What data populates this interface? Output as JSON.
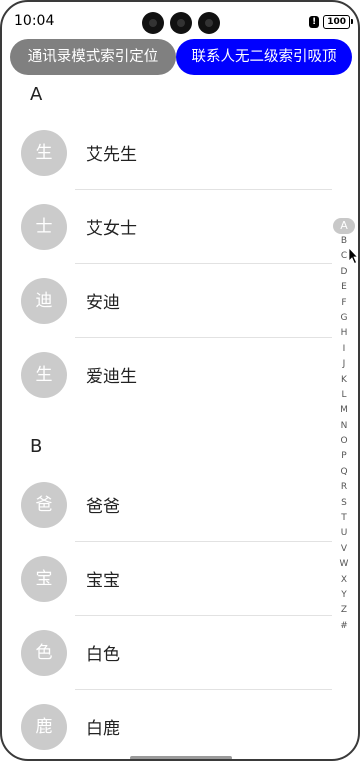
{
  "status_bar": {
    "time": "10:04",
    "alert": "!",
    "battery": "100"
  },
  "buttons": {
    "index_locate_label": "通讯录模式索引定位",
    "no_secondary_label": "联系人无二级索引吸顶"
  },
  "sections": [
    {
      "letter": "A",
      "contacts": [
        {
          "avatar": "生",
          "name": "艾先生"
        },
        {
          "avatar": "士",
          "name": "艾女士"
        },
        {
          "avatar": "迪",
          "name": "安迪"
        },
        {
          "avatar": "生",
          "name": "爱迪生"
        }
      ]
    },
    {
      "letter": "B",
      "contacts": [
        {
          "avatar": "爸",
          "name": "爸爸"
        },
        {
          "avatar": "宝",
          "name": "宝宝"
        },
        {
          "avatar": "色",
          "name": "白色"
        },
        {
          "avatar": "鹿",
          "name": "白鹿"
        }
      ]
    }
  ],
  "alphabet_index": {
    "selected": "A",
    "letters": [
      "A",
      "B",
      "C",
      "D",
      "E",
      "F",
      "G",
      "H",
      "I",
      "J",
      "K",
      "L",
      "M",
      "N",
      "O",
      "P",
      "Q",
      "R",
      "S",
      "T",
      "U",
      "V",
      "W",
      "X",
      "Y",
      "Z",
      "#"
    ]
  },
  "colors": {
    "button_gray": "#808080",
    "button_blue": "#0000ff",
    "avatar_bg": "#cbcbcb"
  }
}
